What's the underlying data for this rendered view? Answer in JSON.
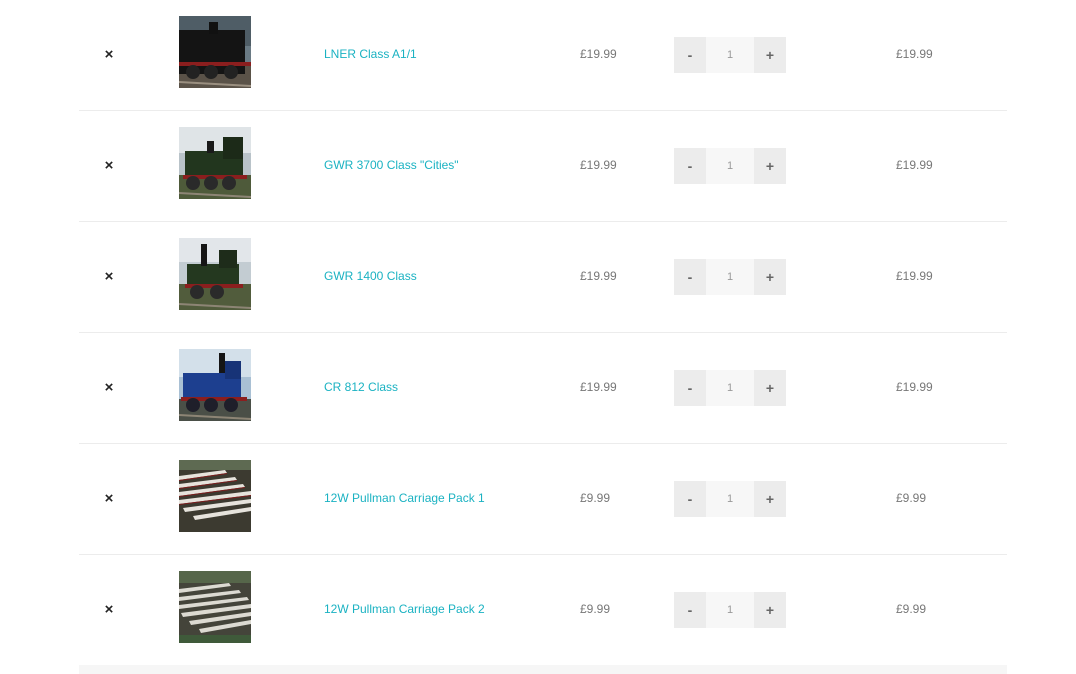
{
  "cart": {
    "remove_symbol": "×",
    "minus_symbol": "-",
    "plus_symbol": "+",
    "rows": [
      {
        "name": "LNER Class A1/1",
        "price": "£19.99",
        "quantity": "1",
        "subtotal": "£19.99",
        "thumbnail": "black-locomotive"
      },
      {
        "name": "GWR 3700 Class \"Cities\"",
        "price": "£19.99",
        "quantity": "1",
        "subtotal": "£19.99",
        "thumbnail": "green-locomotive"
      },
      {
        "name": "GWR 1400 Class",
        "price": "£19.99",
        "quantity": "1",
        "subtotal": "£19.99",
        "thumbnail": "green-tank-locomotive"
      },
      {
        "name": "CR 812 Class",
        "price": "£19.99",
        "quantity": "1",
        "subtotal": "£19.99",
        "thumbnail": "blue-locomotive"
      },
      {
        "name": "12W Pullman Carriage Pack 1",
        "price": "£9.99",
        "quantity": "1",
        "subtotal": "£9.99",
        "thumbnail": "carriage-yard"
      },
      {
        "name": "12W Pullman Carriage Pack 2",
        "price": "£9.99",
        "quantity": "1",
        "subtotal": "£9.99",
        "thumbnail": "carriage-yard"
      }
    ]
  },
  "colors": {
    "link": "#1ab2c2",
    "text": "#777777",
    "button_bg": "#ececec",
    "divider": "#ececec"
  }
}
